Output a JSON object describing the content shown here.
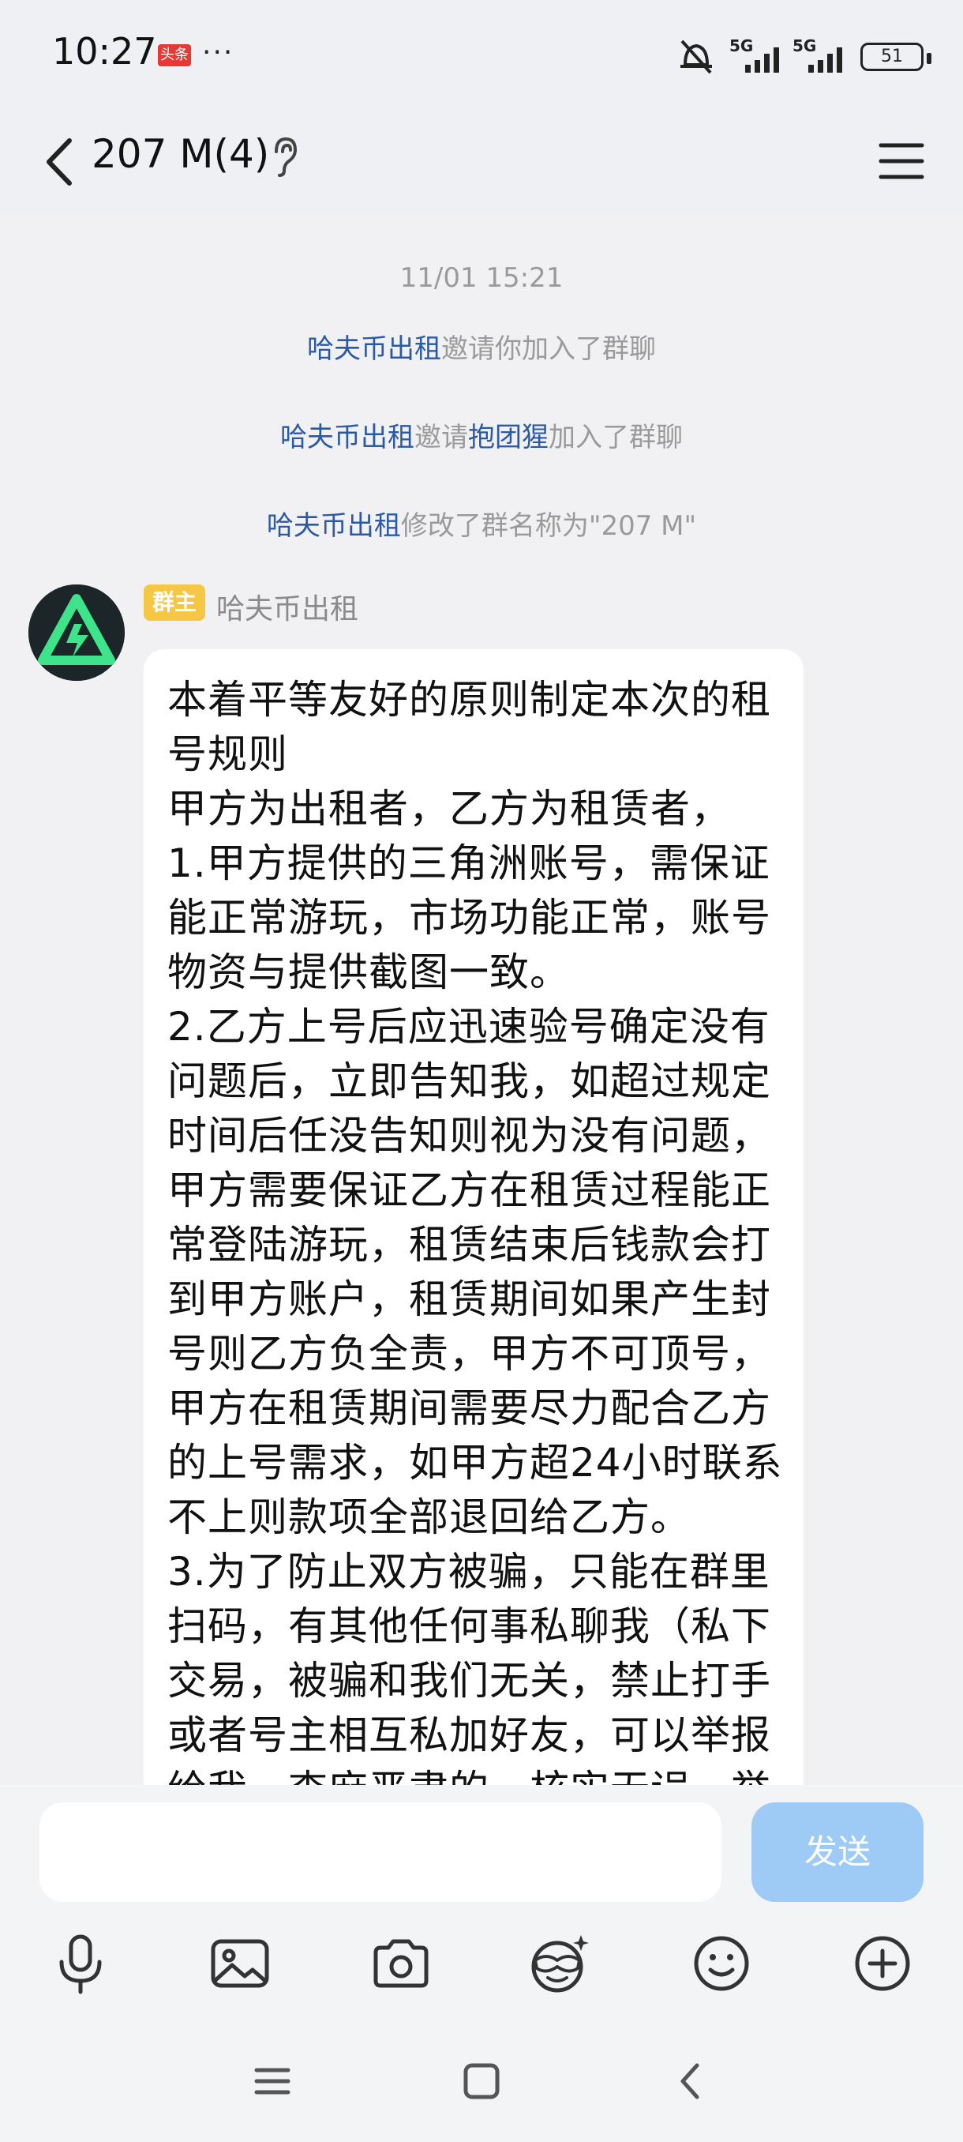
{
  "status_bar": {
    "time": "10:27",
    "news_badge": "头条",
    "more": "···",
    "network_1": "5G",
    "network_2": "5G",
    "battery": "51"
  },
  "header": {
    "title": "207 M(4)"
  },
  "chat": {
    "timestamp": "11/01 15:21",
    "system_messages": [
      {
        "actor": "哈夫币出租",
        "text": "邀请你加入了群聊"
      },
      {
        "actor": "哈夫币出租",
        "mid": "邀请",
        "target": "抱团猩",
        "text": "加入了群聊"
      },
      {
        "actor": "哈夫币出租",
        "text": "修改了群名称为\"207 M\""
      }
    ],
    "message": {
      "role_badge": "群主",
      "sender": "哈夫币出租",
      "text": "本着平等友好的原则制定本次的租号规则\n甲方为出租者，乙方为租赁者，\n1.甲方提供的三角洲账号，需保证能正常游玩，市场功能正常，账号物资与提供截图一致。\n2.乙方上号后应迅速验号确定没有问题后，立即告知我，如超过规定时间后任没告知则视为没有问题，甲方需要保证乙方在租赁过程能正常登陆游玩，租赁结束后钱款会打到甲方账户，租赁期间如果产生封号则乙方负全责，甲方不可顶号，甲方在租赁期间需要尽力配合乙方的上号需求，如甲方超24小时联系不上则款项全部退回给乙方。\n3.为了防止双方被骗，只能在群里扫码，有其他任何事私聊我（私下交易，被骗和我们无关，禁止打手或者号主相互私加好友，可以举报给我，查麻严肃的，核实无误，举"
    }
  },
  "input": {
    "value": "",
    "send_label": "发送"
  },
  "toolbar": [
    "voice-icon",
    "image-icon",
    "camera-icon",
    "face-effect-icon",
    "emoji-icon",
    "plus-icon"
  ],
  "nav": [
    "menu-icon",
    "home-icon",
    "back-icon"
  ]
}
